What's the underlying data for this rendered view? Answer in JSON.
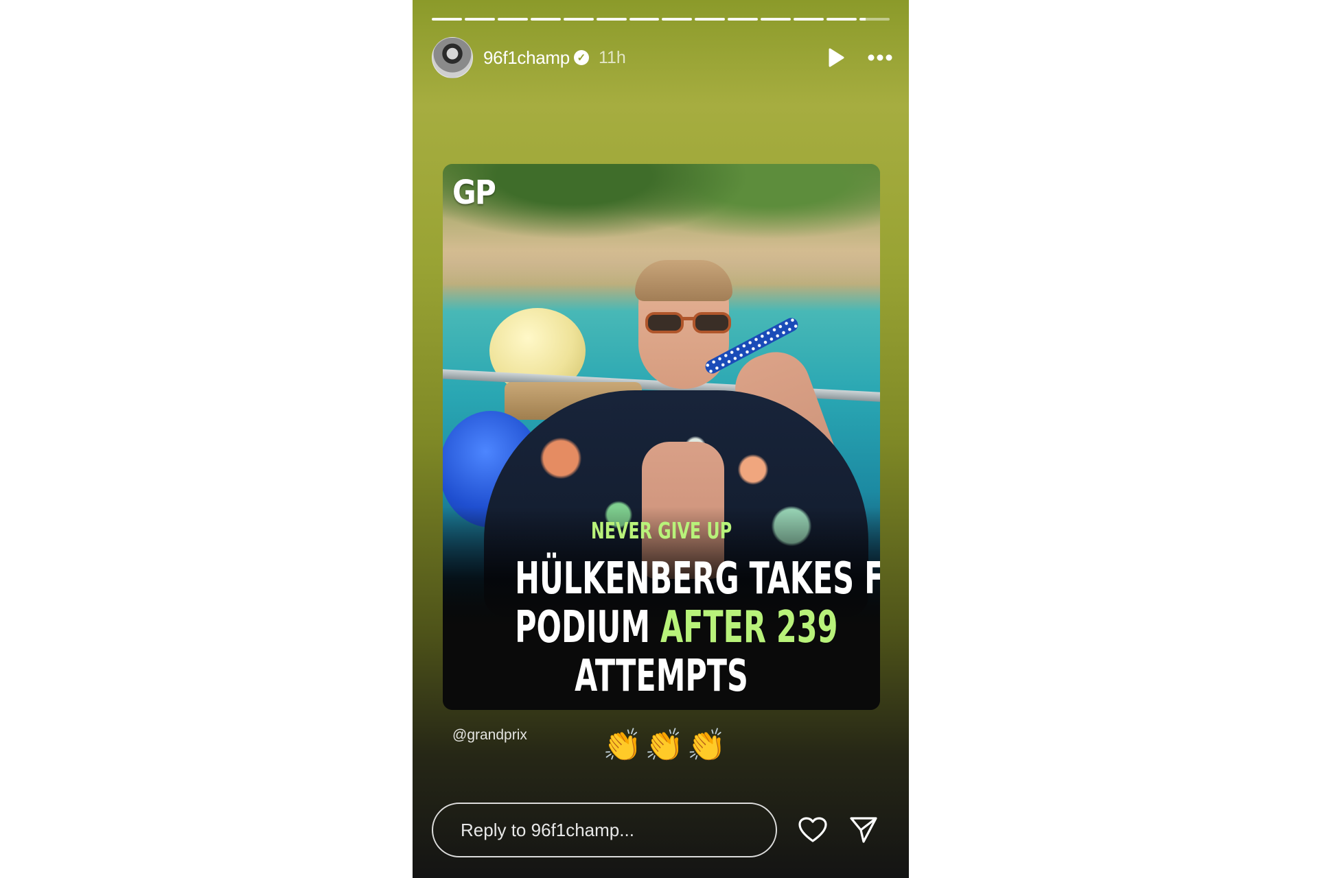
{
  "story": {
    "progress": {
      "segment_count": 14,
      "active_segment_index": 13,
      "active_segment_progress": 0.2
    },
    "header": {
      "username": "96f1champ",
      "verified_glyph": "✓",
      "time_ago": "11h",
      "play_icon": "play-icon",
      "more_icon": "more-horizontal-icon"
    },
    "post": {
      "logo_text": "GP",
      "kicker": "NEVER GIVE UP",
      "headline_line1": "HÜLKENBERG TAKES FIRST",
      "headline_line2_white": "PODIUM ",
      "headline_line2_green": "AFTER 239",
      "headline_line3": "ATTEMPTS"
    },
    "mention": "@grandprix",
    "emojis": "👏👏👏",
    "reply": {
      "placeholder": "Reply to 96f1champ..."
    },
    "actions": {
      "like_icon": "heart-icon",
      "share_icon": "send-icon"
    }
  },
  "colors": {
    "accent_green": "#b8f27a",
    "text_white": "#ffffff",
    "gradient_top": "#a6ad40",
    "gradient_bottom": "#141414"
  }
}
